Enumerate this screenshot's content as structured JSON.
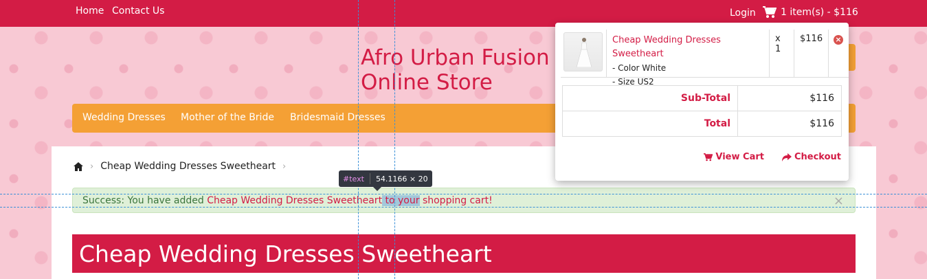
{
  "topbar": {
    "home": "Home",
    "contact": "Contact Us",
    "login": "Login",
    "cart_summary": "1 item(s) - $116",
    "cart_icon": "shopping-cart-icon"
  },
  "header": {
    "store_name": "Afro Urban Fusion Online Store"
  },
  "menu": {
    "items": [
      "Wedding Dresses",
      "Mother of the Bride",
      "Bridesmaid Dresses"
    ]
  },
  "breadcrumb": {
    "home_icon": "home-icon",
    "current": "Cheap Wedding Dresses Sweetheart"
  },
  "alert": {
    "prefix": "Success: You have added ",
    "product_link_a": "Cheap Wedding Dresses Sweetheart",
    "selected_text": " to your",
    "suffix": " shopping cart!",
    "close": "×"
  },
  "product": {
    "title": "Cheap Wedding Dresses Sweetheart"
  },
  "cart_dropdown": {
    "item": {
      "name": "Cheap Wedding Dresses Sweetheart",
      "color": "- Color White",
      "size": "- Size US2",
      "qty": "x 1",
      "price": "$116",
      "remove_icon": "remove-icon"
    },
    "subtotal_label": "Sub-Total",
    "subtotal_value": "$116",
    "total_label": "Total",
    "total_value": "$116",
    "view_cart": "View Cart",
    "checkout": "Checkout"
  },
  "devtools": {
    "tag": "#text",
    "size": "54.1166 × 20"
  },
  "colors": {
    "brand": "#d31c45",
    "accent": "#f4a035",
    "alert_bg": "#dff0d8"
  }
}
